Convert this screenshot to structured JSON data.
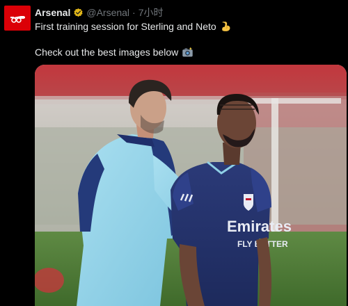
{
  "account": {
    "name": "Arsenal",
    "handle": "@Arsenal",
    "separator": "·",
    "time": "7小时",
    "avatar_icon": "arsenal-cannon-icon",
    "verified_icon": "verified-gold-badge-icon",
    "brand_color": "#db0007",
    "verified_color": "#e2b719"
  },
  "tweet": {
    "line1": "First training session for Sterling and Neto",
    "line1_emoji": "flexed-biceps-icon",
    "line2": "Check out the best images below",
    "line2_emoji": "camera-flash-icon"
  },
  "media": {
    "kit_text_1": "Emirates",
    "kit_text_2": "FLY BETTER"
  }
}
